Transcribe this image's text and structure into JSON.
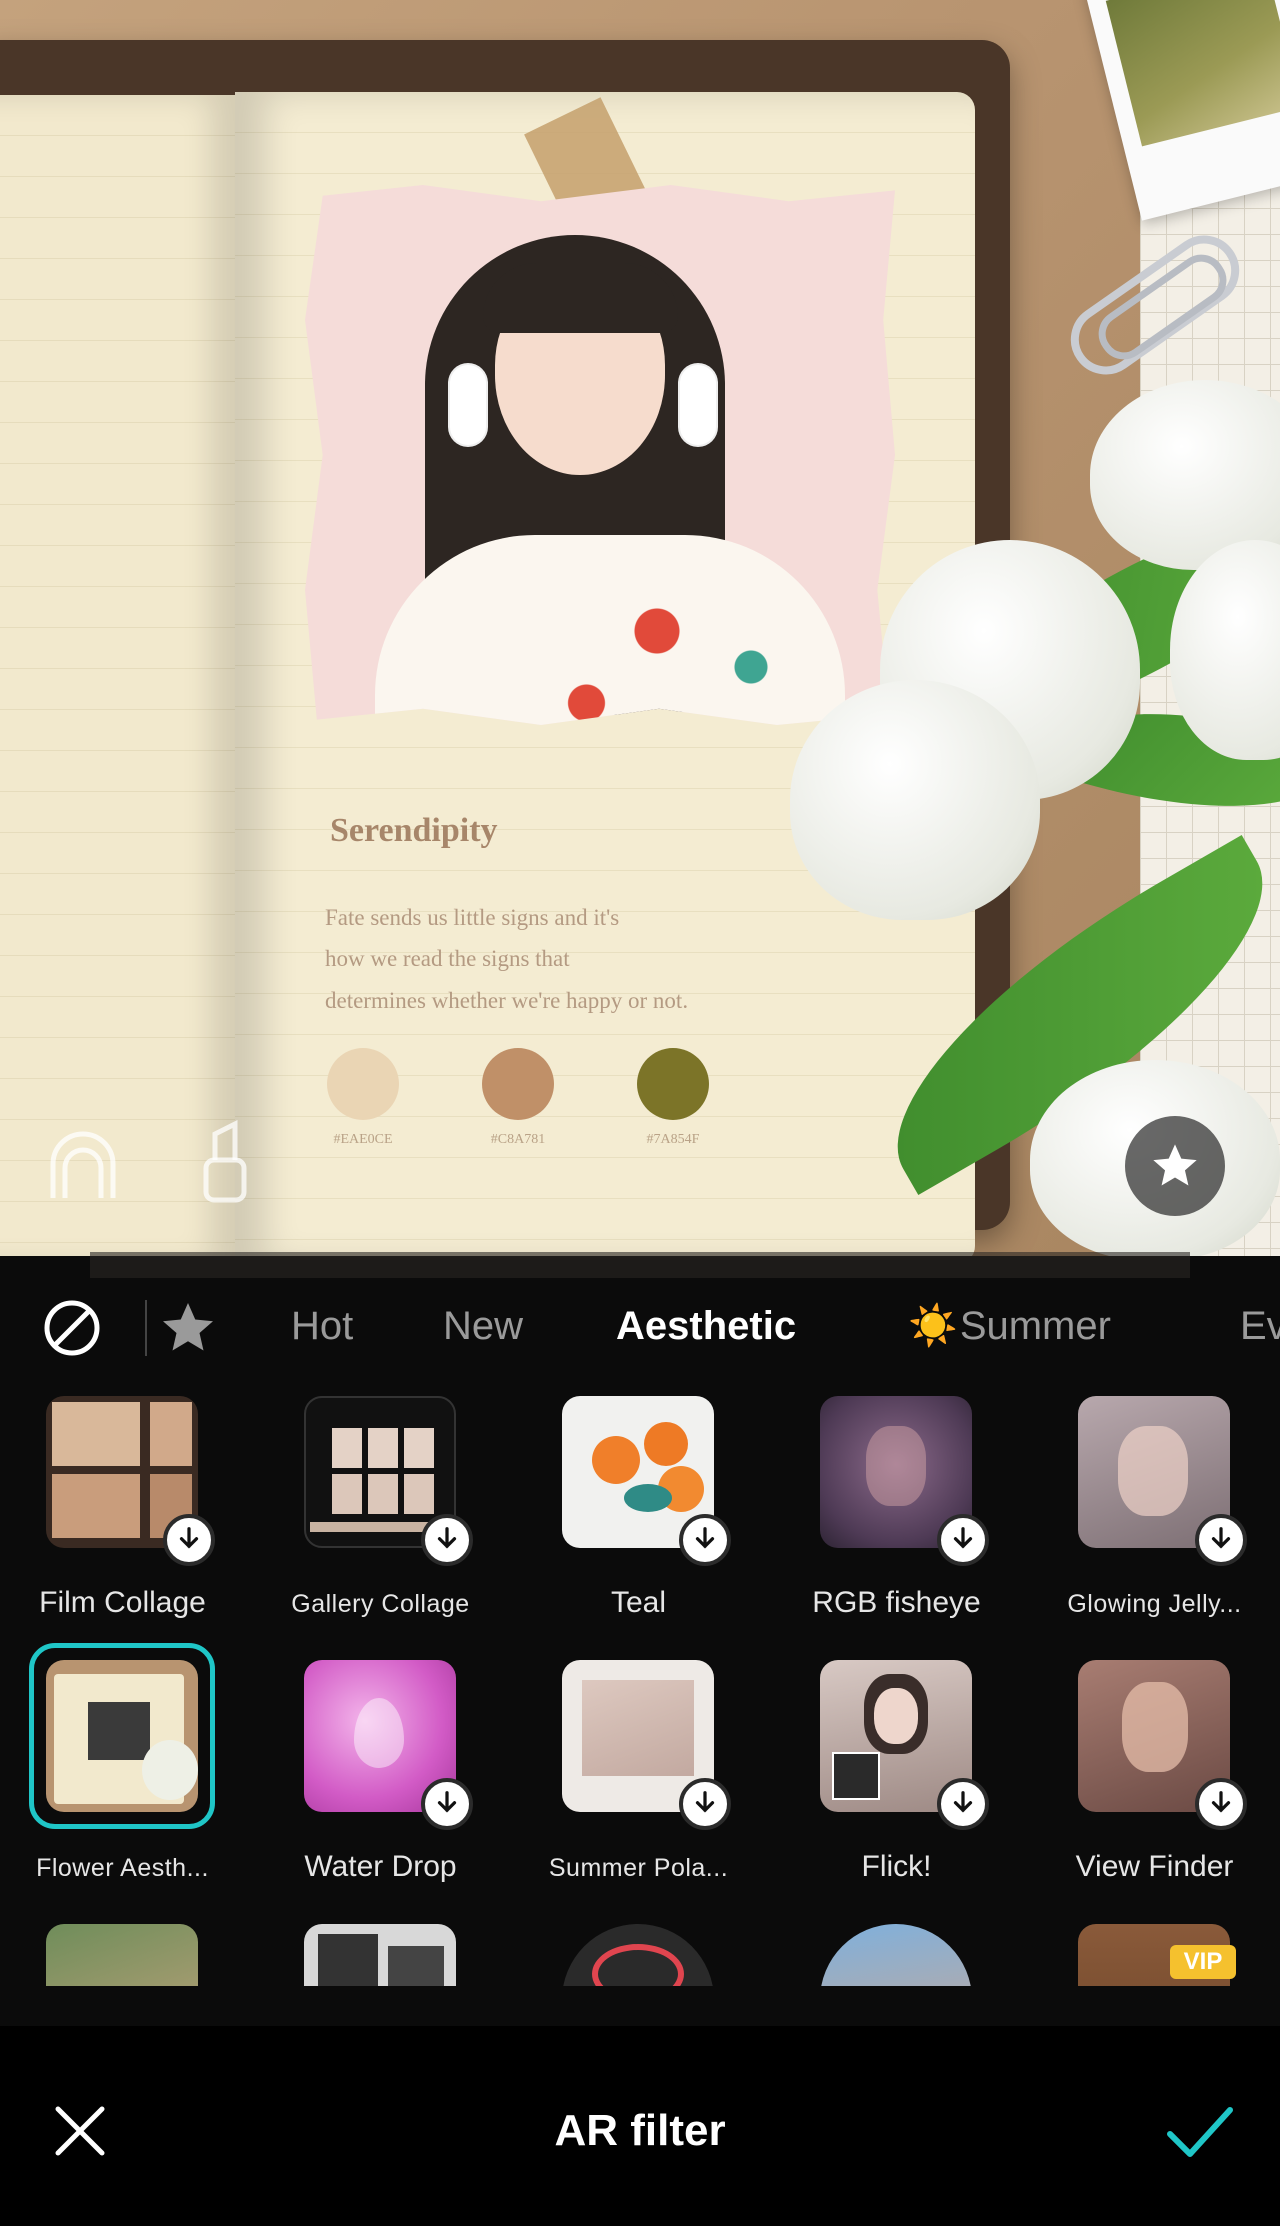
{
  "preview": {
    "notebook_title": "Serendipity",
    "notebook_lines": [
      "Fate sends us little signs and it's",
      "how we read the signs that",
      "determines whether we're happy or not."
    ],
    "swatches": [
      {
        "color": "#EAE0CE",
        "label": "#EAE0CE"
      },
      {
        "color": "#C8A781",
        "label": "#C8A781"
      },
      {
        "color": "#7A854F",
        "label": "#7A854F"
      }
    ],
    "icons": {
      "left_tool_1": "face-retouch-icon",
      "left_tool_2": "lipstick-icon",
      "favorite": "star-icon"
    }
  },
  "tabs": {
    "none_icon": "prohibited-icon",
    "favorites_icon": "star-icon",
    "items": [
      {
        "label": "Hot",
        "active": false
      },
      {
        "label": "New",
        "active": false
      },
      {
        "label": "Aesthetic",
        "active": true
      },
      {
        "label": "Summer",
        "active": false,
        "emoji": "☀️"
      },
      {
        "label": "Ev",
        "active": false
      }
    ]
  },
  "filters": [
    {
      "label": "Film Collage",
      "downloadable": true,
      "selected": false
    },
    {
      "label": "Gallery Collage",
      "downloadable": true,
      "selected": false
    },
    {
      "label": "Teal",
      "downloadable": true,
      "selected": false
    },
    {
      "label": "RGB fisheye",
      "downloadable": true,
      "selected": false
    },
    {
      "label": "Glowing Jelly...",
      "downloadable": true,
      "selected": false
    },
    {
      "label": "Flower Aesth...",
      "downloadable": false,
      "selected": true
    },
    {
      "label": "Water Drop",
      "downloadable": true,
      "selected": false
    },
    {
      "label": "Summer Pola...",
      "downloadable": true,
      "selected": false
    },
    {
      "label": "Flick!",
      "downloadable": true,
      "selected": false
    },
    {
      "label": "View Finder",
      "downloadable": true,
      "selected": false
    }
  ],
  "vip_badge": "VIP",
  "bottom_bar": {
    "title": "AR filter",
    "close_icon": "close-icon",
    "confirm_icon": "checkmark-icon"
  },
  "colors": {
    "accent_teal": "#1FC6C7",
    "panel_bg": "#0B0B0B",
    "active_tab": "#FFFFFF",
    "inactive_tab": "#9A9A9A"
  }
}
